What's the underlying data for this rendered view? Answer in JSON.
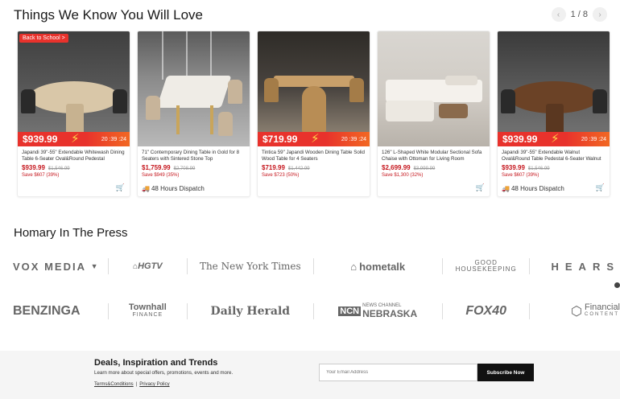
{
  "section_title": "Things We Know You Will Love",
  "pager": {
    "text": "1 / 8",
    "prev": "‹",
    "next": "›"
  },
  "products": [
    {
      "badge": "Back to School >",
      "banner_price": "$939.99",
      "timer": "20 :39 :24",
      "name": "Japandi 39\"-55\" Extendable Whitewash Dining Table 6-Seater Oval&Round Pedestal",
      "price": "$939.99",
      "orig": "$1,546.99",
      "save": "Save $607 (39%)",
      "dispatch": ""
    },
    {
      "badge": "",
      "banner_price": "",
      "timer": "",
      "name": "71\" Contemporary Dining Table in Gold for 8 Seaters with Sintered Stone Top",
      "price": "$1,759.99",
      "orig": "$2,708.99",
      "save": "Save $949 (35%)",
      "dispatch": "48 Hours Dispatch"
    },
    {
      "badge": "",
      "banner_price": "$719.99",
      "timer": "20 :39 :24",
      "name": "Tintica 59\" Japandi Wooden Dining Table Solid Wood Table for 4 Seaters",
      "price": "$719.99",
      "orig": "$1,442.99",
      "save": "Save $723 (50%)",
      "dispatch": ""
    },
    {
      "badge": "",
      "banner_price": "",
      "timer": "",
      "name": "126\" L-Shaped White Modular Sectional Sofa Chaise with Ottoman for Living Room",
      "price": "$2,699.99",
      "orig": "$3,999.99",
      "save": "Save $1,300 (32%)",
      "dispatch": ""
    },
    {
      "badge": "",
      "banner_price": "$939.99",
      "timer": "20 :39 :24",
      "name": "Japandi 39\"-55\" Extendable Walnut Oval&Round Table Pedestal 6-Seater Walnut Oval&Round Table Pedestal",
      "price": "$939.99",
      "orig": "$1,546.99",
      "save": "Save $607 (39%)",
      "dispatch": "48 Hours Dispatch"
    }
  ],
  "press": {
    "title": "Homary In The Press",
    "row1": {
      "vox": "VOX MEDIA",
      "hgtv": "HGTV",
      "nyt": "The New York Times",
      "hometalk": "hometalk",
      "gh_line1": "GOOD",
      "gh_line2": "HOUSEKEEPING",
      "hears": "HEARS"
    },
    "row2": {
      "benzinga": "BENZINGA",
      "townhall": "Townhall",
      "townhall_sub": "FINANCE",
      "dailyherald": "Daily Herald",
      "news_small": "NEWS CHANNEL",
      "news_big": "NEBRASKA",
      "news_mark": "NCN",
      "fox": "FOX40",
      "fin_big": "Financial",
      "fin_small": "CONTENT"
    }
  },
  "footer": {
    "title": "Deals, Inspiration and Trends",
    "subtitle": "Learn more about special offers, promotions, events and more.",
    "terms": "Terms&Conditions",
    "sep": "|",
    "privacy": "Privacy Policy",
    "email_placeholder": "Your Email Address",
    "subscribe": "Subscribe Now"
  }
}
